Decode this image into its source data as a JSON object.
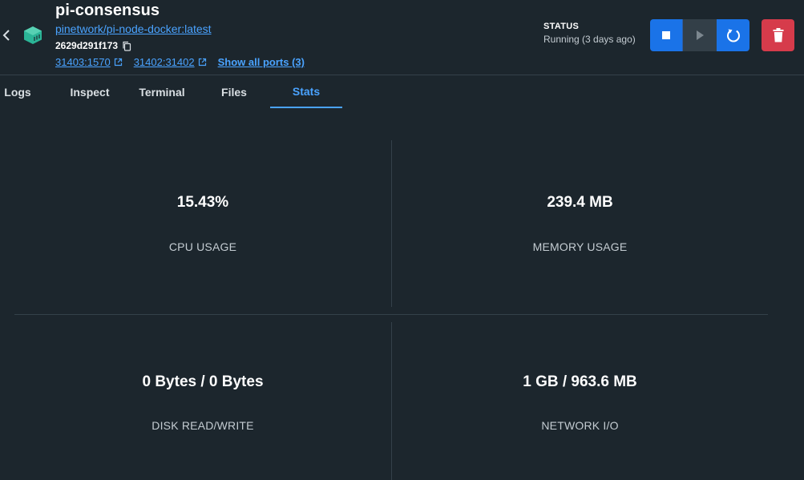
{
  "container": {
    "name": "pi-consensus",
    "image": "pinetwork/pi-node-docker:latest",
    "id": "2629d291f173",
    "ports": [
      "31403:1570",
      "31402:31402"
    ],
    "show_all_ports": "Show all ports (3)"
  },
  "status": {
    "label": "STATUS",
    "value": "Running (3 days ago)"
  },
  "tabs": [
    {
      "label": "Logs"
    },
    {
      "label": "Inspect"
    },
    {
      "label": "Terminal"
    },
    {
      "label": "Files"
    },
    {
      "label": "Stats",
      "active": true
    }
  ],
  "stats": {
    "cpu": {
      "value": "15.43%",
      "label": "CPU USAGE"
    },
    "memory": {
      "value": "239.4 MB",
      "label": "MEMORY USAGE"
    },
    "disk": {
      "value": "0 Bytes / 0 Bytes",
      "label": "DISK READ/WRITE"
    },
    "network": {
      "value": "1 GB / 963.6 MB",
      "label": "NETWORK I/O"
    }
  },
  "colors": {
    "background": "#1c262d",
    "accent": "#1a73e8",
    "link": "#4aa3ff",
    "danger": "#d63b4b",
    "container_icon": "#2bb597"
  },
  "icons": {
    "back": "chevron-left-icon",
    "container": "container-icon",
    "copy": "copy-icon",
    "external": "external-link-icon",
    "stop": "stop-icon",
    "start": "play-icon",
    "restart": "restart-icon",
    "delete": "trash-icon"
  }
}
